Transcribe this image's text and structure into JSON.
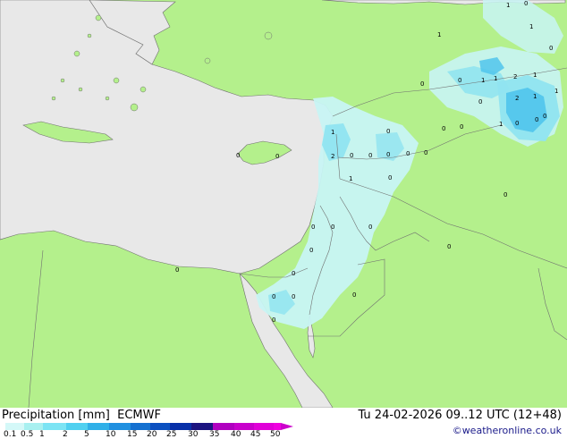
{
  "title": "Precipitation [mm]",
  "model": "ECMWF",
  "valid_time": "Tu 24-02-2026 09..12 UTC (12+48)",
  "credit": "©weatheronline.co.uk",
  "legend": {
    "ticks": [
      "0.1",
      "0.5",
      "1",
      "2",
      "5",
      "10",
      "15",
      "20",
      "25",
      "30",
      "35",
      "40",
      "45",
      "50"
    ],
    "colors": [
      "#d4f8f8",
      "#a8f0f0",
      "#7ce4f4",
      "#50d0f0",
      "#30b0e8",
      "#2090e0",
      "#1470d0",
      "#0c50c0",
      "#0830a8",
      "#1c1480",
      "#b000c0",
      "#c800cc",
      "#e000d8",
      "#f000e0"
    ]
  },
  "colors": {
    "land": "#b4f08c",
    "sea": "#e8e8e8",
    "border": "#707070",
    "precip_light": "#c8f4f4",
    "precip_mid": "#90e4f0",
    "precip_heavy": "#50c4ec"
  },
  "station_values": [
    "1",
    "0",
    "1",
    "1",
    "0",
    "1",
    "2",
    "1",
    "1",
    "1",
    "0",
    "2",
    "1",
    "0",
    "1",
    "0",
    "0",
    "0",
    "0",
    "1",
    "2",
    "0",
    "0",
    "0",
    "0",
    "0",
    "1",
    "0",
    "0",
    "0",
    "0",
    "0",
    "0",
    "0",
    "0",
    "0",
    "0",
    "0",
    "0",
    "0",
    "0",
    "0",
    "0",
    "0",
    "0"
  ]
}
